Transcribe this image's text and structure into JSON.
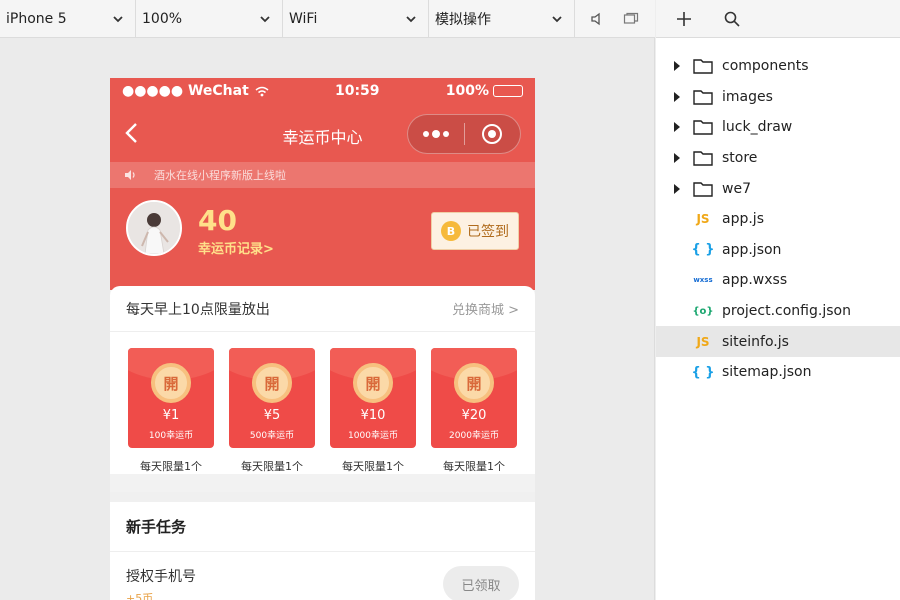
{
  "toolbar": {
    "device": "iPhone 5",
    "zoom": "100%",
    "network": "WiFi",
    "operation": "模拟操作"
  },
  "phone": {
    "status": {
      "carrier": "●●●●● WeChat",
      "time": "10:59",
      "battery": "100%"
    },
    "nav_title": "幸运币中心",
    "notice": "酒水在线小程序新版上线啦",
    "profile": {
      "coins": "40",
      "coin_record": "幸运币记录>",
      "signin_label": "已签到",
      "coin_icon_letter": "B"
    },
    "exchange": {
      "title": "每天早上10点限量放出",
      "link": "兑换商城 >",
      "packets": [
        {
          "open": "開",
          "amount": "¥1",
          "coins": "100幸运币",
          "limit": "每天限量1个"
        },
        {
          "open": "開",
          "amount": "¥5",
          "coins": "500幸运币",
          "limit": "每天限量1个"
        },
        {
          "open": "開",
          "amount": "¥10",
          "coins": "1000幸运币",
          "limit": "每天限量1个"
        },
        {
          "open": "開",
          "amount": "¥20",
          "coins": "2000幸运币",
          "limit": "每天限量1个"
        }
      ]
    },
    "tasks": {
      "title": "新手任务",
      "items": [
        {
          "name": "授权手机号",
          "reward": "+5币",
          "button": "已领取"
        }
      ]
    }
  },
  "file_tree": {
    "items": [
      {
        "name": "components",
        "type": "folder"
      },
      {
        "name": "images",
        "type": "folder"
      },
      {
        "name": "luck_draw",
        "type": "folder"
      },
      {
        "name": "store",
        "type": "folder"
      },
      {
        "name": "we7",
        "type": "folder"
      },
      {
        "name": "app.js",
        "type": "js",
        "badge": "JS"
      },
      {
        "name": "app.json",
        "type": "json",
        "badge": "{ }"
      },
      {
        "name": "app.wxss",
        "type": "wxss",
        "badge": "wxss"
      },
      {
        "name": "project.config.json",
        "type": "cfg",
        "badge": "{o}"
      },
      {
        "name": "siteinfo.js",
        "type": "js",
        "badge": "JS",
        "selected": true
      },
      {
        "name": "sitemap.json",
        "type": "json",
        "badge": "{ }"
      }
    ]
  },
  "colors": {
    "brand_red": "#e85850",
    "packet_red": "#ef4b48",
    "coin_gold": "#ffe08a",
    "selected_row": "#e7e7e7"
  }
}
